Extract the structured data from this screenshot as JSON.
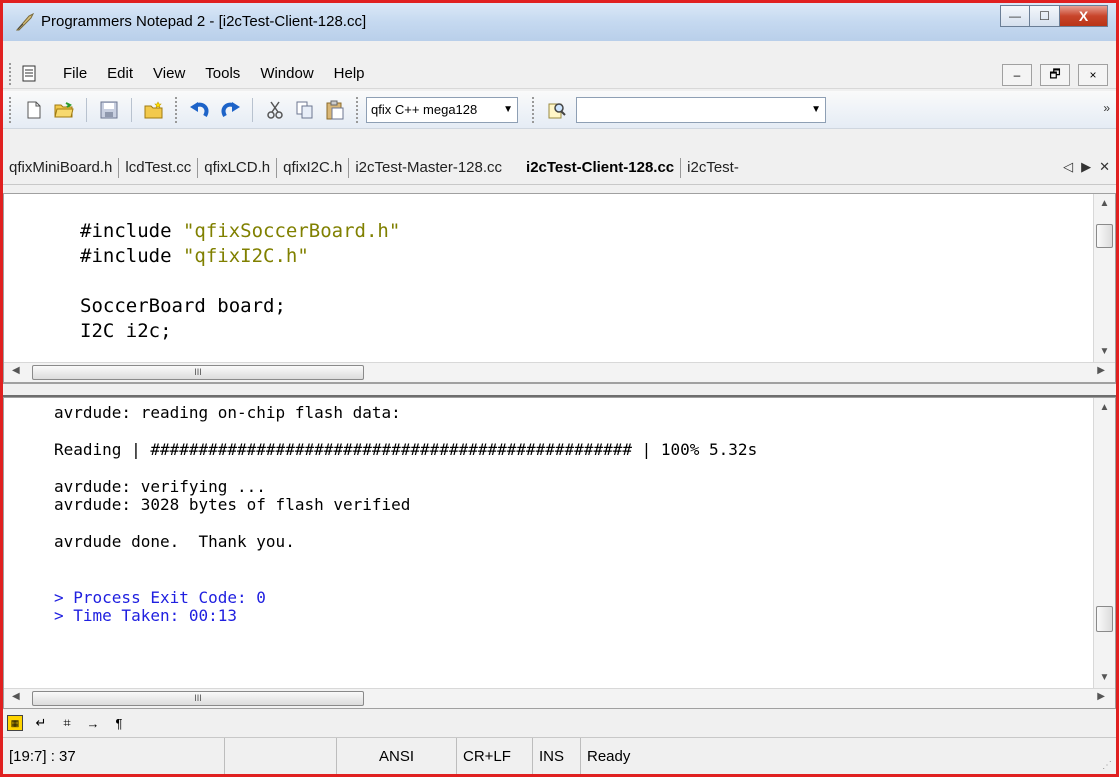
{
  "window": {
    "title": "Programmers Notepad 2 - [i2cTest-Client-128.cc]",
    "controls": {
      "minimize": "—",
      "maximize": "☐",
      "close": "X"
    }
  },
  "menu": {
    "items": [
      "File",
      "Edit",
      "View",
      "Tools",
      "Window",
      "Help"
    ],
    "mdi": {
      "minimize": "–",
      "restore": "🗗",
      "close": "×"
    }
  },
  "toolbar": {
    "scheme_selected": "qfix C++ mega128",
    "search_value": "",
    "overflow": "»"
  },
  "tabs": {
    "items": [
      {
        "label": "qfixMiniBoard.h"
      },
      {
        "label": "lcdTest.cc"
      },
      {
        "label": "qfixLCD.h"
      },
      {
        "label": "qfixI2C.h"
      },
      {
        "label": "i2cTest-Master-128.cc"
      },
      {
        "label": "i2cTest-Client-128.cc"
      },
      {
        "label": "i2cTest-"
      }
    ],
    "active_index": 5
  },
  "editor": {
    "lines": [
      {
        "pre": "#include ",
        "str": "\"qfixSoccerBoard.h\""
      },
      {
        "pre": "#include ",
        "str": "\"qfixI2C.h\""
      },
      {
        "pre": "",
        "str": ""
      },
      {
        "pre": "SoccerBoard board;",
        "str": ""
      },
      {
        "pre": "I2C i2c;",
        "str": ""
      }
    ]
  },
  "output": {
    "lines": [
      "avrdude: reading on-chip flash data:",
      "",
      "Reading | ################################################## | 100% 5.32s",
      "",
      "avrdude: verifying ...",
      "avrdude: 3028 bytes of flash verified",
      "",
      "avrdude done.  Thank you.",
      "",
      "",
      "> Process Exit Code: 0",
      "> Time Taken: 00:13"
    ]
  },
  "scroll": {
    "thumb_grip": "III"
  },
  "status": {
    "position": "[19:7] : 37",
    "blank": "",
    "encoding": "ANSI",
    "line_endings": "CR+LF",
    "mode": "INS",
    "state": "Ready"
  }
}
